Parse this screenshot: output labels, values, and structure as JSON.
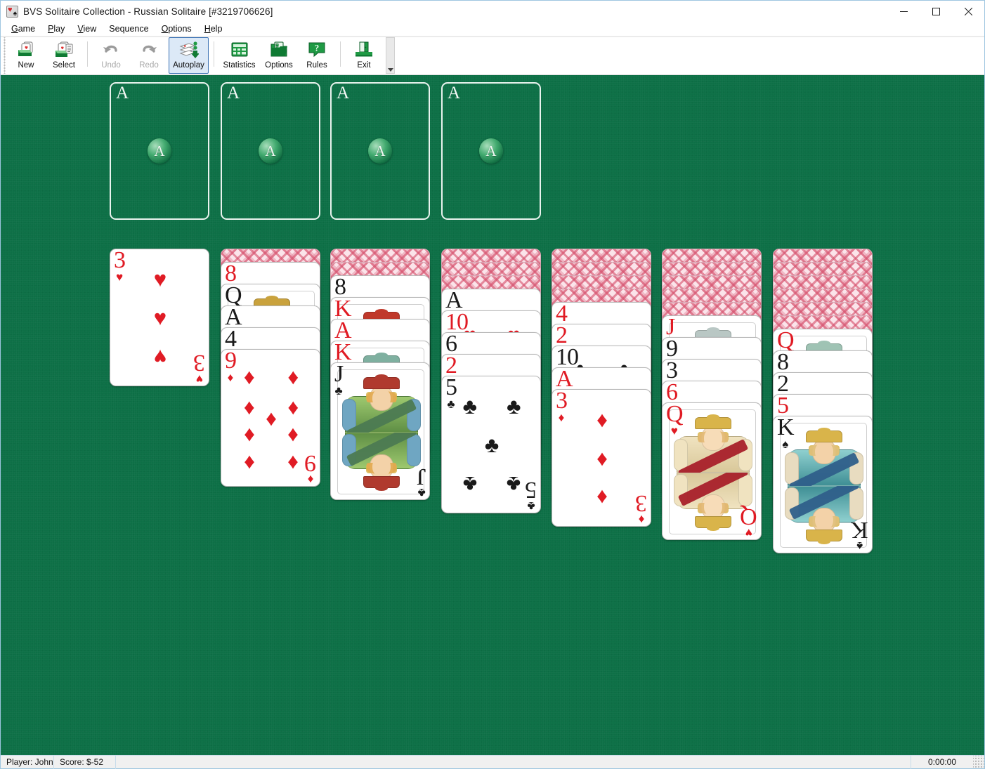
{
  "window": {
    "title": "BVS Solitaire Collection  -  Russian Solitaire [#3219706626]",
    "app_icon": "cards-icon",
    "controls": {
      "minimize": "minimize-icon",
      "maximize": "maximize-icon",
      "close": "close-icon"
    }
  },
  "menubar": {
    "items": [
      {
        "label": "Game",
        "accel": "G"
      },
      {
        "label": "Play",
        "accel": "P"
      },
      {
        "label": "View",
        "accel": "V"
      },
      {
        "label": "Sequence",
        "accel": ""
      },
      {
        "label": "Options",
        "accel": "O"
      },
      {
        "label": "Help",
        "accel": "H"
      }
    ]
  },
  "toolbar": {
    "buttons": [
      {
        "label": "New",
        "icon": "new-deal-icon",
        "enabled": true,
        "active": false
      },
      {
        "label": "Select",
        "icon": "select-game-icon",
        "enabled": true,
        "active": false
      },
      {
        "label": "Undo",
        "icon": "undo-arrow-icon",
        "enabled": false,
        "active": false
      },
      {
        "label": "Redo",
        "icon": "redo-arrow-icon",
        "enabled": false,
        "active": false
      },
      {
        "label": "Autoplay",
        "icon": "autoplay-icon",
        "enabled": true,
        "active": true
      },
      {
        "label": "Statistics",
        "icon": "statistics-icon",
        "enabled": true,
        "active": false
      },
      {
        "label": "Options",
        "icon": "options-icon",
        "enabled": true,
        "active": false
      },
      {
        "label": "Rules",
        "icon": "rules-help-icon",
        "enabled": true,
        "active": false
      },
      {
        "label": "Exit",
        "icon": "exit-door-icon",
        "enabled": true,
        "active": false
      }
    ],
    "overflow_icon": "toolbar-overflow-icon"
  },
  "statusbar": {
    "player": "Player: John",
    "score": "Score: $-52",
    "time": "0:00:00",
    "resize_grip": "resize-grip-icon"
  },
  "colors": {
    "felt": "#0d7046",
    "card_red": "#e01b24",
    "card_black": "#1a1a1a",
    "card_back": "#e4889f",
    "accent": "#3c72b4"
  },
  "game": {
    "name": "Russian Solitaire",
    "deal_number": "#3219706626",
    "foundations": [
      {
        "placeholder_rank": "A",
        "orb_label": "A",
        "cards": []
      },
      {
        "placeholder_rank": "A",
        "orb_label": "A",
        "cards": []
      },
      {
        "placeholder_rank": "A",
        "orb_label": "A",
        "cards": []
      },
      {
        "placeholder_rank": "A",
        "orb_label": "A",
        "cards": []
      }
    ],
    "tableau": [
      {
        "column": 1,
        "facedown": 0,
        "faceup": [
          {
            "rank": "3",
            "suit": "hearts",
            "color": "red"
          }
        ]
      },
      {
        "column": 2,
        "facedown": 1,
        "faceup": [
          {
            "rank": "8",
            "suit": "hearts",
            "color": "red"
          },
          {
            "rank": "Q",
            "suit": "spades",
            "color": "black"
          },
          {
            "rank": "A",
            "suit": "spades",
            "color": "black"
          },
          {
            "rank": "4",
            "suit": "spades",
            "color": "black"
          },
          {
            "rank": "9",
            "suit": "diamonds",
            "color": "red"
          }
        ]
      },
      {
        "column": 3,
        "facedown": 2,
        "faceup": [
          {
            "rank": "8",
            "suit": "spades",
            "color": "black"
          },
          {
            "rank": "K",
            "suit": "hearts",
            "color": "red"
          },
          {
            "rank": "A",
            "suit": "hearts",
            "color": "red"
          },
          {
            "rank": "K",
            "suit": "diamonds",
            "color": "red"
          },
          {
            "rank": "J",
            "suit": "clubs",
            "color": "black"
          }
        ]
      },
      {
        "column": 4,
        "facedown": 3,
        "faceup": [
          {
            "rank": "A",
            "suit": "spades",
            "color": "black"
          },
          {
            "rank": "10",
            "suit": "hearts",
            "color": "red"
          },
          {
            "rank": "6",
            "suit": "clubs",
            "color": "black"
          },
          {
            "rank": "2",
            "suit": "hearts",
            "color": "red"
          },
          {
            "rank": "5",
            "suit": "clubs",
            "color": "black"
          }
        ]
      },
      {
        "column": 5,
        "facedown": 4,
        "faceup": [
          {
            "rank": "4",
            "suit": "hearts",
            "color": "red"
          },
          {
            "rank": "2",
            "suit": "diamonds",
            "color": "red"
          },
          {
            "rank": "10",
            "suit": "clubs",
            "color": "black"
          },
          {
            "rank": "A",
            "suit": "diamonds",
            "color": "red"
          },
          {
            "rank": "3",
            "suit": "diamonds",
            "color": "red"
          }
        ]
      },
      {
        "column": 6,
        "facedown": 5,
        "faceup": [
          {
            "rank": "J",
            "suit": "diamonds",
            "color": "red"
          },
          {
            "rank": "9",
            "suit": "spades",
            "color": "black"
          },
          {
            "rank": "3",
            "suit": "spades",
            "color": "black"
          },
          {
            "rank": "6",
            "suit": "hearts",
            "color": "red"
          },
          {
            "rank": "Q",
            "suit": "hearts",
            "color": "red"
          }
        ]
      },
      {
        "column": 7,
        "facedown": 6,
        "faceup": [
          {
            "rank": "Q",
            "suit": "diamonds",
            "color": "red"
          },
          {
            "rank": "8",
            "suit": "clubs",
            "color": "black"
          },
          {
            "rank": "2",
            "suit": "spades",
            "color": "black"
          },
          {
            "rank": "5",
            "suit": "hearts",
            "color": "red"
          },
          {
            "rank": "K",
            "suit": "spades",
            "color": "black"
          }
        ]
      }
    ]
  }
}
